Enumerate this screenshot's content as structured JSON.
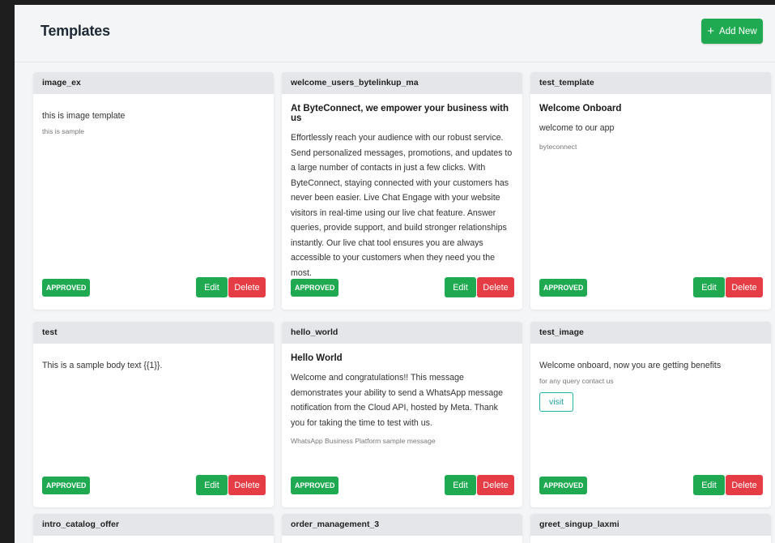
{
  "page": {
    "title": "Templates"
  },
  "header": {
    "add_label": "Add New",
    "add_icon": "plus-icon"
  },
  "card_actions": {
    "edit_label": "Edit",
    "delete_label": "Delete"
  },
  "colors": {
    "approve_green": "#1faa52",
    "delete_red": "#e53c45",
    "link_teal": "#20b2aa"
  },
  "cards": [
    {
      "name": "image_ex",
      "title": "",
      "body": "this is image template",
      "footer": "this is sample",
      "button": "",
      "status": "APPROVED"
    },
    {
      "name": "welcome_users_bytelinkup_ma",
      "title": "At ByteConnect, we empower your business with us",
      "body": "Effortlessly reach your audience with our robust service. Send personalized messages, promotions, and updates to a large number of contacts in just a few clicks. With ByteConnect, staying connected with your customers has never been easier. Live Chat Engage with your website visitors in real-time using our live chat feature. Answer queries, provide support, and build stronger relationships instantly. Our live chat tool ensures you are always accessible to your customers when they need you the most.",
      "footer": "",
      "button": "",
      "status": "APPROVED"
    },
    {
      "name": "test_template",
      "title": "Welcome Onboard",
      "body": "welcome to our app",
      "footer": "byteconnect",
      "button": "",
      "status": "APPROVED"
    },
    {
      "name": "test",
      "title": "",
      "body": "This is a sample body text {{1}}.",
      "footer": "",
      "button": "",
      "status": "APPROVED"
    },
    {
      "name": "hello_world",
      "title": "Hello World",
      "body": "Welcome and congratulations!! This message demonstrates your ability to send a WhatsApp message notification from the Cloud API, hosted by Meta. Thank you for taking the time to test with us.",
      "footer": "WhatsApp Business Platform sample message",
      "button": "",
      "status": "APPROVED"
    },
    {
      "name": "test_image",
      "title": "",
      "body": "Welcome onboard, now you are getting benefits",
      "footer": "for any query contact us",
      "button": "visit",
      "status": "APPROVED"
    },
    {
      "name": "intro_catalog_offer",
      "title": "",
      "body": "",
      "footer": "",
      "button": "",
      "status": ""
    },
    {
      "name": "order_management_3",
      "title": "",
      "body": "",
      "footer": "",
      "button": "",
      "status": ""
    },
    {
      "name": "greet_singup_laxmi",
      "title": "",
      "body": "",
      "footer": "",
      "button": "",
      "status": ""
    }
  ]
}
